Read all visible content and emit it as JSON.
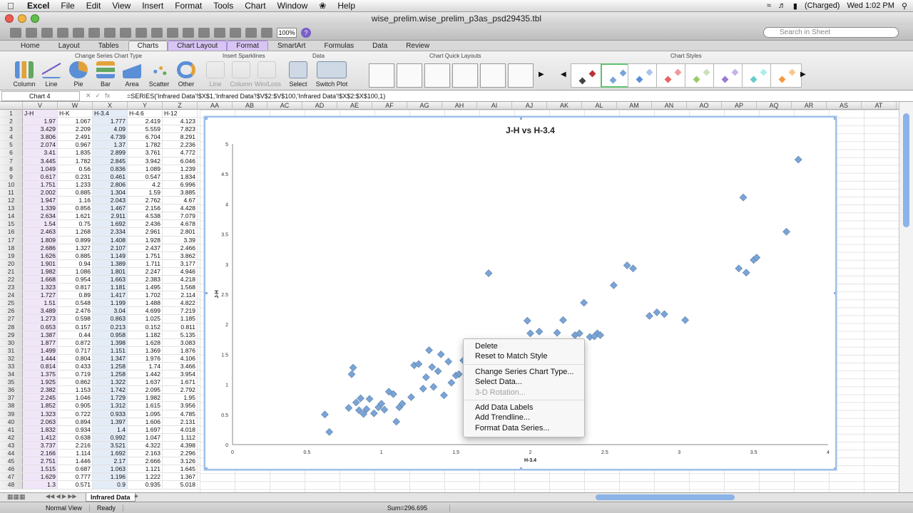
{
  "menubar": {
    "app": "Excel",
    "items": [
      "File",
      "Edit",
      "View",
      "Insert",
      "Format",
      "Tools",
      "Chart",
      "Window",
      "Help"
    ],
    "battery": "(Charged)",
    "clock": "Wed 1:02 PM"
  },
  "window": {
    "title": "wise_prelim.wise_prelim_p3as_psd29435.tbl"
  },
  "toolbar": {
    "zoom": "100%",
    "search_placeholder": "Search in Sheet"
  },
  "ribbon": {
    "tabs": [
      "Home",
      "Layout",
      "Tables",
      "Charts",
      "Chart Layout",
      "Format",
      "SmartArt",
      "Formulas",
      "Data",
      "Review"
    ],
    "groups": {
      "insert_chart": "Change Series Chart Type",
      "sparklines": "Insert Sparklines",
      "data": "Data",
      "layouts": "Chart Quick Layouts",
      "styles": "Chart Styles"
    },
    "chart_buttons": [
      "Column",
      "Line",
      "Pie",
      "Bar",
      "Area",
      "Scatter",
      "Other"
    ],
    "spark_buttons": [
      "Line",
      "Column",
      "Win/Loss"
    ],
    "data_buttons": [
      "Select",
      "Switch Plot"
    ]
  },
  "formula_bar": {
    "name_box": "Chart 4",
    "fx": "fx",
    "formula": "=SERIES('Infrared Data'!$X$1,'Infrared Data'!$V$2:$V$100,'Infrared Data'!$X$2:$X$100,1)"
  },
  "columns": [
    "V",
    "W",
    "X",
    "Y",
    "Z",
    "AA",
    "AB",
    "AC",
    "AD",
    "AE",
    "AF",
    "AG",
    "AH",
    "AI",
    "AJ",
    "AK",
    "AL",
    "AM",
    "AN",
    "AO",
    "AP",
    "AQ",
    "AR",
    "AS",
    "AT"
  ],
  "row_numbers": [
    "1",
    "2",
    "3",
    "4",
    "5",
    "6",
    "7",
    "8",
    "9",
    "10",
    "11",
    "12",
    "13",
    "14",
    "15",
    "16",
    "17",
    "18",
    "19",
    "20",
    "21",
    "22",
    "23",
    "24",
    "25",
    "26",
    "27",
    "28",
    "29",
    "30",
    "31",
    "32",
    "33",
    "34",
    "35",
    "36",
    "37",
    "38",
    "39",
    "40",
    "41",
    "42",
    "43",
    "44",
    "45",
    "46",
    "47",
    "48"
  ],
  "table": {
    "headers": [
      "J-H",
      "H-K",
      "H-3.4",
      "H-4.6",
      "H-12"
    ],
    "rows": [
      [
        "1.97",
        "1.067",
        "1.777",
        "2.419",
        "4.123"
      ],
      [
        "3.429",
        "2.209",
        "4.09",
        "5.559",
        "7.823"
      ],
      [
        "3.806",
        "2.491",
        "4.739",
        "6.704",
        "8.291"
      ],
      [
        "2.074",
        "0.967",
        "1.37",
        "1.782",
        "2.236"
      ],
      [
        "3.41",
        "1.835",
        "2.899",
        "3.761",
        "4.772"
      ],
      [
        "3.445",
        "1.782",
        "2.845",
        "3.942",
        "6.046"
      ],
      [
        "1.049",
        "0.56",
        "0.836",
        "1.089",
        "1.239"
      ],
      [
        "0.617",
        "0.231",
        "0.461",
        "0.547",
        "1.834"
      ],
      [
        "1.751",
        "1.233",
        "2.806",
        "4.2",
        "6.996"
      ],
      [
        "2.002",
        "0.885",
        "1.304",
        "1.59",
        "3.885"
      ],
      [
        "1.947",
        "1.16",
        "2.043",
        "2.762",
        "4.67"
      ],
      [
        "1.339",
        "0.856",
        "1.467",
        "2.156",
        "4.428"
      ],
      [
        "2.634",
        "1.621",
        "2.911",
        "4.538",
        "7.079"
      ],
      [
        "1.54",
        "0.75",
        "1.692",
        "2.436",
        "4.678"
      ],
      [
        "2.463",
        "1.268",
        "2.334",
        "2.961",
        "2.801"
      ],
      [
        "1.809",
        "0.899",
        "1.408",
        "1.928",
        "3.39"
      ],
      [
        "2.686",
        "1.327",
        "2.107",
        "2.437",
        "2.466"
      ],
      [
        "1.626",
        "0.885",
        "1.149",
        "1.751",
        "3.862"
      ],
      [
        "1.901",
        "0.94",
        "1.389",
        "1.711",
        "3.177"
      ],
      [
        "1.982",
        "1.086",
        "1.801",
        "2.247",
        "4.946"
      ],
      [
        "1.668",
        "0.954",
        "1.663",
        "2.383",
        "4.218"
      ],
      [
        "1.323",
        "0.817",
        "1.181",
        "1.495",
        "1.568"
      ],
      [
        "1.727",
        "0.89",
        "1.417",
        "1.702",
        "2.114"
      ],
      [
        "1.51",
        "0.548",
        "1.199",
        "1.488",
        "4.822"
      ],
      [
        "3.489",
        "2.476",
        "3.04",
        "4.699",
        "7.219"
      ],
      [
        "1.273",
        "0.598",
        "0.863",
        "1.025",
        "1.185"
      ],
      [
        "0.653",
        "0.157",
        "0.213",
        "0.152",
        "0.811"
      ],
      [
        "1.387",
        "0.44",
        "0.958",
        "1.182",
        "5.135"
      ],
      [
        "1.877",
        "0.872",
        "1.398",
        "1.628",
        "3.083"
      ],
      [
        "1.499",
        "0.717",
        "1.151",
        "1.369",
        "1.876"
      ],
      [
        "1.444",
        "0.804",
        "1.347",
        "1.976",
        "4.106"
      ],
      [
        "0.814",
        "0.433",
        "1.258",
        "1.74",
        "3.466"
      ],
      [
        "1.375",
        "0.719",
        "1.258",
        "1.442",
        "3.954"
      ],
      [
        "1.925",
        "0.862",
        "1.322",
        "1.637",
        "1.671"
      ],
      [
        "2.382",
        "1.153",
        "1.742",
        "2.095",
        "2.792"
      ],
      [
        "2.245",
        "1.046",
        "1.729",
        "1.982",
        "1.95"
      ],
      [
        "1.852",
        "0.905",
        "1.312",
        "1.615",
        "3.956"
      ],
      [
        "1.323",
        "0.722",
        "0.933",
        "1.095",
        "4.785"
      ],
      [
        "2.063",
        "0.894",
        "1.397",
        "1.606",
        "2.131"
      ],
      [
        "1.832",
        "0.934",
        "1.4",
        "1.697",
        "4.018"
      ],
      [
        "1.412",
        "0.638",
        "0.992",
        "1.047",
        "1.112"
      ],
      [
        "3.737",
        "2.216",
        "3.521",
        "4.322",
        "4.398"
      ],
      [
        "2.166",
        "1.114",
        "1.692",
        "2.163",
        "2.296"
      ],
      [
        "2.751",
        "1.446",
        "2.17",
        "2.666",
        "3.126"
      ],
      [
        "1.515",
        "0.687",
        "1.063",
        "1.121",
        "1.645"
      ],
      [
        "1.629",
        "0.777",
        "1.196",
        "1.222",
        "1.367"
      ],
      [
        "1.3",
        "0.571",
        "0.9",
        "0.935",
        "5.018"
      ]
    ]
  },
  "chart_data": {
    "type": "scatter",
    "title": "J-H vs H-3.4",
    "xlabel": "H-3.4",
    "ylabel": "J-H",
    "xlim": [
      0,
      4
    ],
    "ylim": [
      0,
      5
    ],
    "xticks": [
      "0",
      "0.5",
      "1",
      "1.5",
      "2",
      "2.5",
      "3",
      "3.5",
      "4"
    ],
    "yticks": [
      "0",
      "0.5",
      "1",
      "1.5",
      "2",
      "2.5",
      "3",
      "3.5",
      "4",
      "4.5",
      "5"
    ],
    "marker_color": "#7aa4d6",
    "points": [
      [
        0.62,
        0.5
      ],
      [
        0.65,
        0.21
      ],
      [
        0.78,
        0.61
      ],
      [
        0.8,
        1.17
      ],
      [
        0.81,
        1.28
      ],
      [
        0.83,
        0.7
      ],
      [
        0.85,
        0.57
      ],
      [
        0.86,
        0.77
      ],
      [
        0.88,
        0.51
      ],
      [
        0.9,
        0.59
      ],
      [
        0.92,
        0.76
      ],
      [
        0.95,
        0.52
      ],
      [
        0.98,
        0.62
      ],
      [
        1.0,
        0.68
      ],
      [
        1.02,
        0.58
      ],
      [
        1.05,
        0.88
      ],
      [
        1.08,
        0.84
      ],
      [
        1.1,
        0.38
      ],
      [
        1.12,
        0.62
      ],
      [
        1.14,
        0.68
      ],
      [
        1.2,
        0.79
      ],
      [
        1.22,
        1.32
      ],
      [
        1.25,
        1.34
      ],
      [
        1.28,
        0.93
      ],
      [
        1.3,
        1.12
      ],
      [
        1.32,
        1.57
      ],
      [
        1.34,
        1.29
      ],
      [
        1.35,
        0.96
      ],
      [
        1.38,
        1.22
      ],
      [
        1.4,
        1.5
      ],
      [
        1.42,
        0.82
      ],
      [
        1.45,
        1.38
      ],
      [
        1.47,
        1.03
      ],
      [
        1.5,
        1.15
      ],
      [
        1.52,
        1.17
      ],
      [
        1.55,
        1.4
      ],
      [
        1.72,
        2.85
      ],
      [
        1.76,
        1.5
      ],
      [
        1.8,
        1.65
      ],
      [
        1.8,
        1.63
      ],
      [
        1.98,
        2.06
      ],
      [
        2.0,
        1.85
      ],
      [
        2.06,
        1.88
      ],
      [
        2.18,
        1.86
      ],
      [
        2.22,
        2.07
      ],
      [
        2.3,
        1.82
      ],
      [
        2.33,
        1.85
      ],
      [
        2.4,
        1.79
      ],
      [
        2.45,
        1.85
      ],
      [
        2.43,
        1.8
      ],
      [
        2.47,
        1.82
      ],
      [
        2.36,
        2.36
      ],
      [
        2.56,
        2.65
      ],
      [
        2.65,
        2.98
      ],
      [
        2.69,
        2.93
      ],
      [
        2.8,
        2.14
      ],
      [
        2.85,
        2.2
      ],
      [
        2.9,
        2.17
      ],
      [
        3.04,
        2.07
      ],
      [
        3.4,
        2.93
      ],
      [
        3.43,
        4.11
      ],
      [
        3.45,
        2.86
      ],
      [
        3.5,
        3.07
      ],
      [
        3.52,
        3.11
      ],
      [
        3.72,
        3.54
      ],
      [
        3.8,
        4.74
      ]
    ]
  },
  "context_menu": {
    "items": [
      {
        "label": "Delete",
        "enabled": true
      },
      {
        "label": "Reset to Match Style",
        "enabled": true
      },
      {
        "sep": true
      },
      {
        "label": "Change Series Chart Type...",
        "enabled": true
      },
      {
        "label": "Select Data...",
        "enabled": true
      },
      {
        "label": "3-D Rotation...",
        "enabled": false
      },
      {
        "sep": true
      },
      {
        "label": "Add Data Labels",
        "enabled": true
      },
      {
        "label": "Add Trendline...",
        "enabled": true
      },
      {
        "label": "Format Data Series...",
        "enabled": true
      }
    ]
  },
  "sheet_tab": "Infrared Data",
  "status": {
    "view": "Normal View",
    "state": "Ready",
    "sum": "Sum=296.695"
  }
}
